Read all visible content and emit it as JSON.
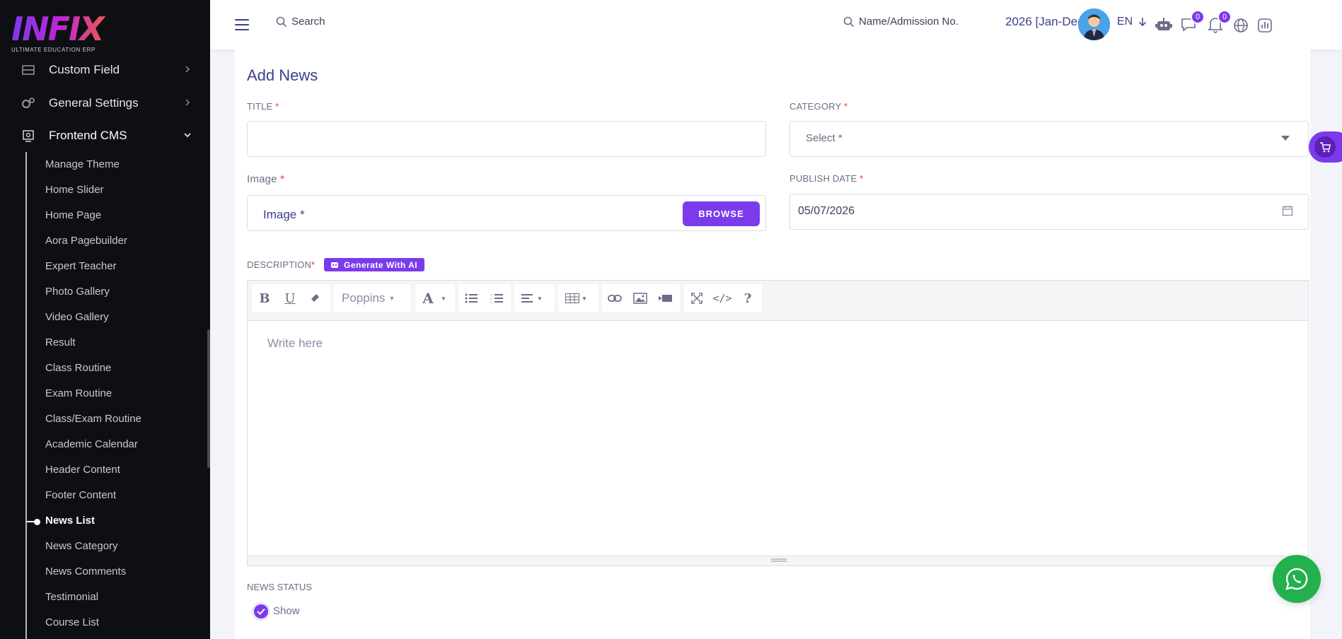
{
  "brand": {
    "name": "INFIX",
    "tagline": "ULTIMATE EDUCATION ERP"
  },
  "sidebar": {
    "main_items": [
      {
        "label": "Custom Field",
        "icon": "custom-field-icon"
      },
      {
        "label": "General Settings",
        "icon": "gears-icon"
      },
      {
        "label": "Frontend CMS",
        "icon": "cms-icon"
      }
    ],
    "sub_items": [
      "Manage Theme",
      "Home Slider",
      "Home Page",
      "Aora Pagebuilder",
      "Expert Teacher",
      "Photo Gallery",
      "Video Gallery",
      "Result",
      "Class Routine",
      "Exam Routine",
      "Class/Exam Routine",
      "Academic Calendar",
      "Header Content",
      "Footer Content",
      "News List",
      "News Category",
      "News Comments",
      "Testimonial",
      "Course List"
    ],
    "active_item": "News List"
  },
  "header": {
    "search_label": "Search",
    "student_search_label": "Name/Admission No.",
    "session": "2026 [Jan-Dec]",
    "language": "EN",
    "chat_count": "0",
    "notification_count": "0"
  },
  "form": {
    "title": "Add News",
    "title_label": "TITLE",
    "category_label": "CATEGORY",
    "category_placeholder": "Select *",
    "image_label": "Image",
    "image_placeholder": "Image *",
    "browse_label": "BROWSE",
    "publish_date_label": "PUBLISH DATE",
    "publish_date_value": "05/07/2026",
    "description_label": "DESCRIPTION",
    "generate_ai_label": "Generate With AI",
    "editor_font": "Poppins",
    "editor_placeholder": "Write here",
    "news_status_label": "NEWS STATUS",
    "status_option": "Show",
    "required_mark": "*"
  },
  "colors": {
    "accent": "#7c3aed",
    "sidebar_bg": "#0e0f12",
    "whatsapp": "#22b14c",
    "heading": "#3c3f8c"
  }
}
